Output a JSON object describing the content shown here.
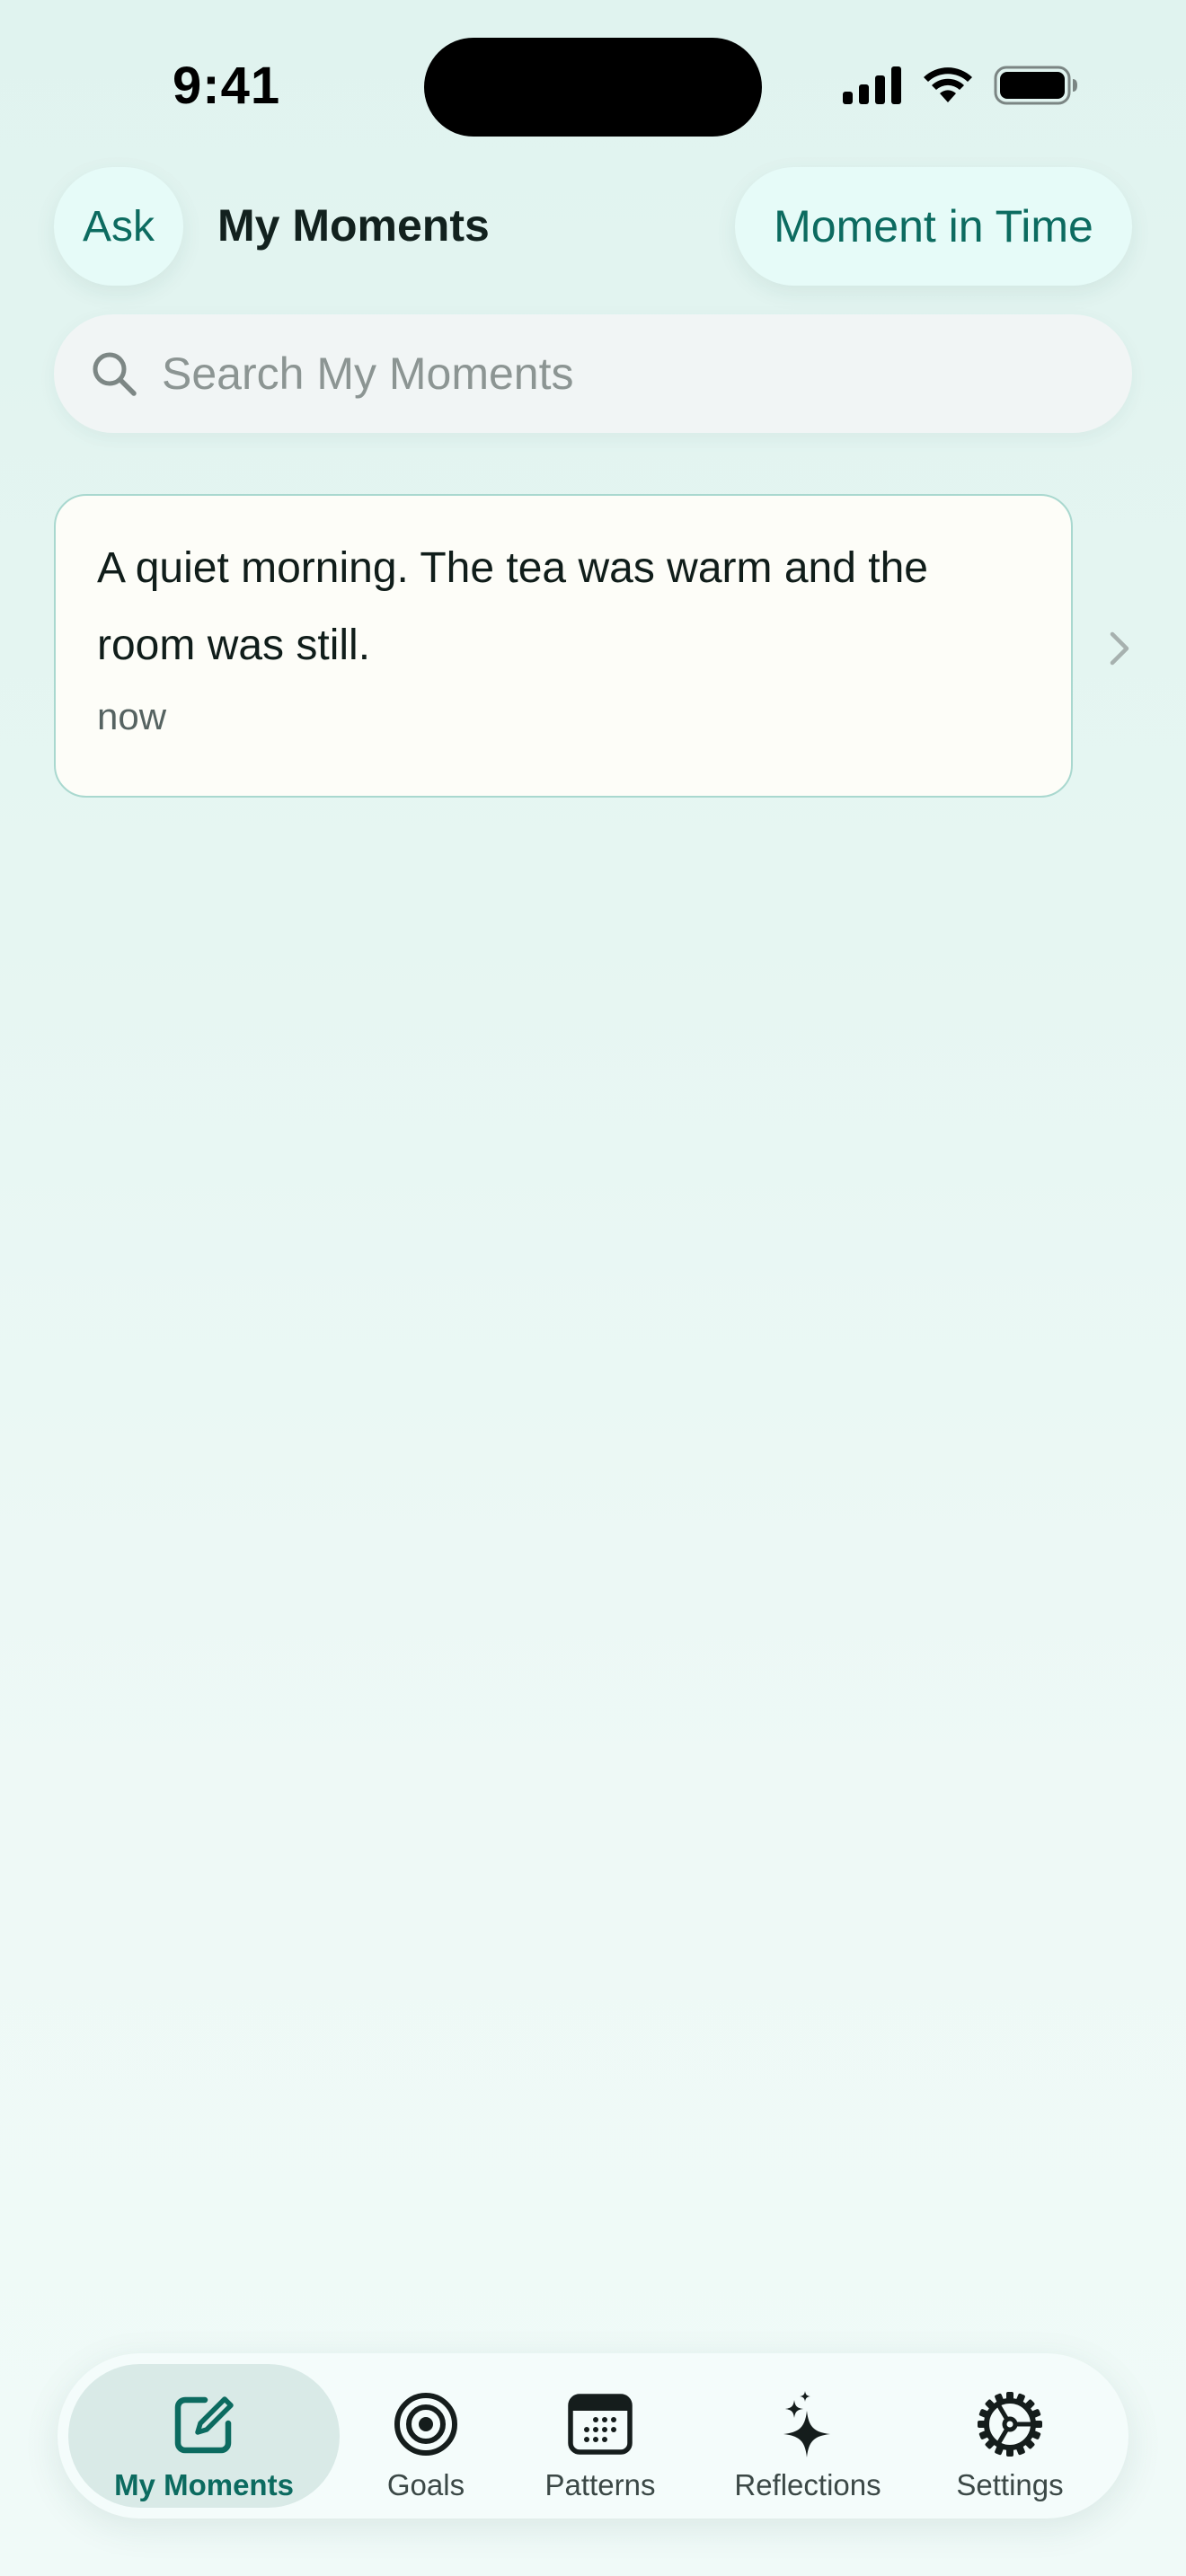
{
  "status_bar": {
    "time": "9:41"
  },
  "header": {
    "ask_label": "Ask",
    "title": "My Moments",
    "moment_in_time_label": "Moment in Time"
  },
  "search": {
    "placeholder": "Search My Moments",
    "value": ""
  },
  "moments": [
    {
      "text": "A quiet morning. The tea was warm and the room was still.",
      "time": "now"
    }
  ],
  "tab_bar": {
    "selected": "My Moments",
    "items": [
      {
        "label": "My Moments",
        "icon": "compose-icon"
      },
      {
        "label": "Goals",
        "icon": "target-icon"
      },
      {
        "label": "Patterns",
        "icon": "calendar-icon"
      },
      {
        "label": "Reflections",
        "icon": "sparkles-icon"
      },
      {
        "label": "Settings",
        "icon": "gear-icon"
      }
    ]
  },
  "colors": {
    "accent": "#0c6b60",
    "background": "#e3f5f1",
    "card_background": "#fdfdf8",
    "card_border": "#a9d8cf",
    "pill_background": "#e6fbf8"
  }
}
